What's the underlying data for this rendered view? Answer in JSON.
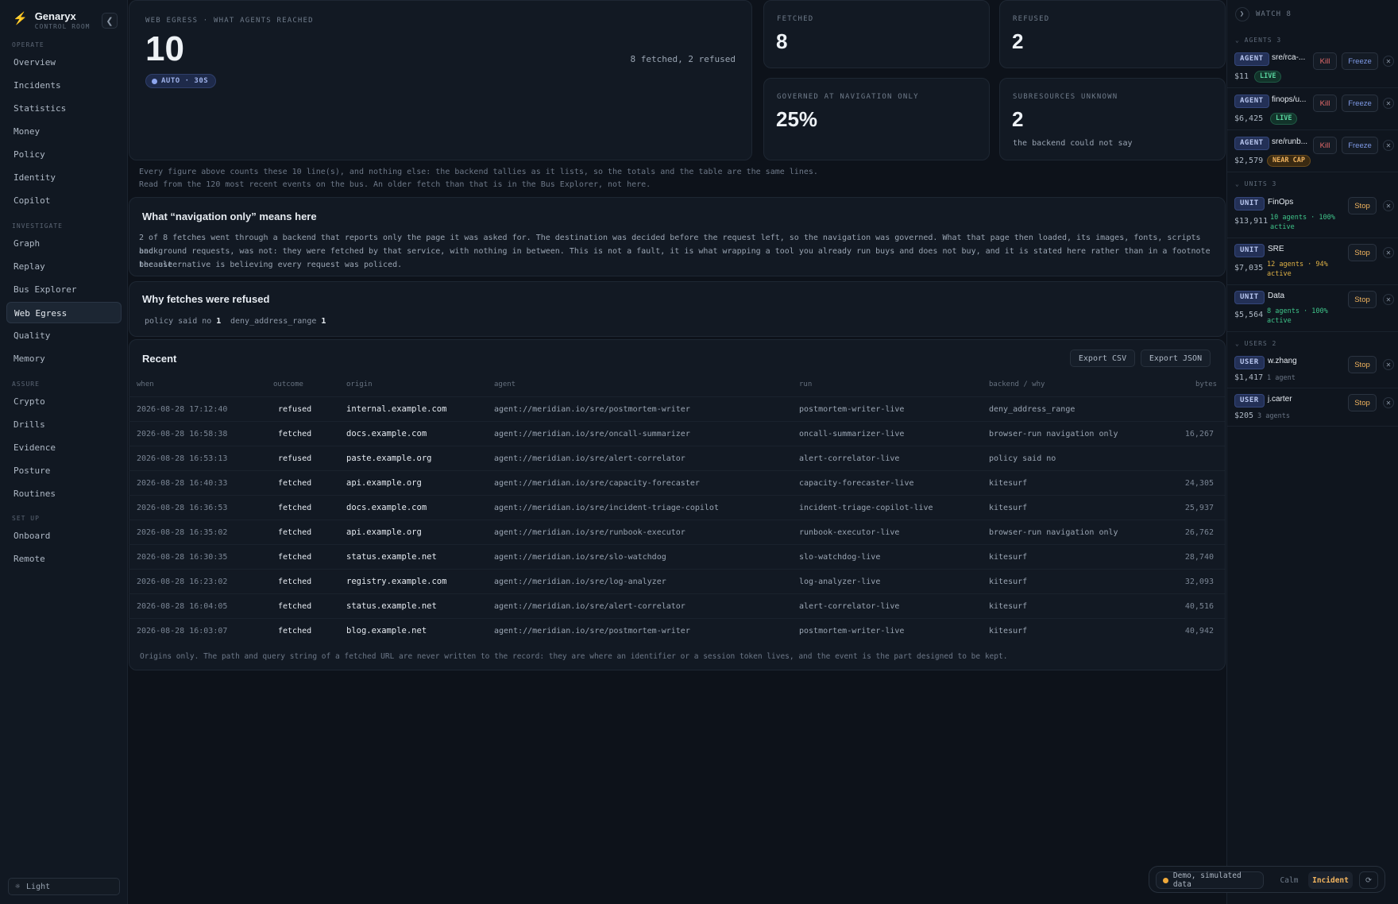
{
  "brand": {
    "name": "Genaryx",
    "subtitle": "CONTROL ROOM"
  },
  "nav": {
    "operate_label": "OPERATE",
    "operate": [
      "Overview",
      "Incidents",
      "Statistics",
      "Money",
      "Policy",
      "Identity",
      "Copilot"
    ],
    "investigate_label": "INVESTIGATE",
    "investigate": [
      "Graph",
      "Replay",
      "Bus Explorer",
      "Web Egress",
      "Quality",
      "Memory"
    ],
    "assure_label": "ASSURE",
    "assure": [
      "Crypto",
      "Drills",
      "Evidence",
      "Posture",
      "Routines"
    ],
    "setup_label": "SET UP",
    "setup": [
      "Onboard",
      "Remote"
    ],
    "active": "Web Egress",
    "theme_label": "Light"
  },
  "hero": {
    "label": "WEB EGRESS · WHAT AGENTS REACHED",
    "value": "10",
    "summary": "8 fetched, 2 refused",
    "auto_chip": "AUTO · 30S"
  },
  "kpis": {
    "fetched": {
      "label": "FETCHED",
      "value": "8"
    },
    "refused": {
      "label": "REFUSED",
      "value": "2"
    },
    "governed": {
      "label": "GOVERNED AT NAVIGATION ONLY",
      "value": "25%"
    },
    "subresources": {
      "label": "SUBRESOURCES UNKNOWN",
      "value": "2",
      "note": "the backend could not say"
    }
  },
  "notes": {
    "line1": "Every figure above counts these 10 line(s), and nothing else: the backend tallies as it lists, so the totals and the table are the same lines.",
    "line2": "Read from the 120 most recent events on the bus. An older fetch than that is in the Bus Explorer, not here."
  },
  "navigation_only": {
    "title": "What “navigation only” means here",
    "line1": "2 of 8 fetches went through a backend that reports only the page it was asked for. The destination was decided before the request left, so the navigation was governed. What that page then loaded, its images, fonts, scripts and",
    "line2": "background requests, was not: they were fetched by that service, with nothing in between. This is not a fault, it is what wrapping a tool you already run buys and does not buy, and it is stated here rather than in a footnote because",
    "line3": "the alternative is believing every request was policed."
  },
  "refusals": {
    "title": "Why fetches were refused",
    "items": [
      {
        "reason": "policy said no",
        "count": "1"
      },
      {
        "reason": "deny_address_range",
        "count": "1"
      }
    ]
  },
  "recent": {
    "title": "Recent",
    "export_csv": "Export CSV",
    "export_json": "Export JSON",
    "columns": {
      "when": "when",
      "outcome": "outcome",
      "origin": "origin",
      "agent": "agent",
      "run": "run",
      "backend": "backend / why",
      "bytes": "bytes"
    },
    "rows": [
      {
        "when": "2026-08-28 17:12:40",
        "outcome": "refused",
        "origin": "internal.example.com",
        "agent": "agent://meridian.io/sre/postmortem-writer",
        "run": "postmortem-writer-live",
        "backend": "deny_address_range",
        "bytes": ""
      },
      {
        "when": "2026-08-28 16:58:38",
        "outcome": "fetched",
        "origin": "docs.example.com",
        "agent": "agent://meridian.io/sre/oncall-summarizer",
        "run": "oncall-summarizer-live",
        "backend": "browser-run navigation only",
        "bytes": "16,267"
      },
      {
        "when": "2026-08-28 16:53:13",
        "outcome": "refused",
        "origin": "paste.example.org",
        "agent": "agent://meridian.io/sre/alert-correlator",
        "run": "alert-correlator-live",
        "backend": "policy said no",
        "bytes": ""
      },
      {
        "when": "2026-08-28 16:40:33",
        "outcome": "fetched",
        "origin": "api.example.org",
        "agent": "agent://meridian.io/sre/capacity-forecaster",
        "run": "capacity-forecaster-live",
        "backend": "kitesurf",
        "bytes": "24,305"
      },
      {
        "when": "2026-08-28 16:36:53",
        "outcome": "fetched",
        "origin": "docs.example.com",
        "agent": "agent://meridian.io/sre/incident-triage-copilot",
        "run": "incident-triage-copilot-live",
        "backend": "kitesurf",
        "bytes": "25,937"
      },
      {
        "when": "2026-08-28 16:35:02",
        "outcome": "fetched",
        "origin": "api.example.org",
        "agent": "agent://meridian.io/sre/runbook-executor",
        "run": "runbook-executor-live",
        "backend": "browser-run navigation only",
        "bytes": "26,762"
      },
      {
        "when": "2026-08-28 16:30:35",
        "outcome": "fetched",
        "origin": "status.example.net",
        "agent": "agent://meridian.io/sre/slo-watchdog",
        "run": "slo-watchdog-live",
        "backend": "kitesurf",
        "bytes": "28,740"
      },
      {
        "when": "2026-08-28 16:23:02",
        "outcome": "fetched",
        "origin": "registry.example.com",
        "agent": "agent://meridian.io/sre/log-analyzer",
        "run": "log-analyzer-live",
        "backend": "kitesurf",
        "bytes": "32,093"
      },
      {
        "when": "2026-08-28 16:04:05",
        "outcome": "fetched",
        "origin": "status.example.net",
        "agent": "agent://meridian.io/sre/alert-correlator",
        "run": "alert-correlator-live",
        "backend": "kitesurf",
        "bytes": "40,516"
      },
      {
        "when": "2026-08-28 16:03:07",
        "outcome": "fetched",
        "origin": "blog.example.net",
        "agent": "agent://meridian.io/sre/postmortem-writer",
        "run": "postmortem-writer-live",
        "backend": "kitesurf",
        "bytes": "40,942"
      }
    ],
    "footnote": "Origins only. The path and query string of a fetched URL are never written to the record: they are where an identifier or a session token lives, and the event is the part designed to be kept."
  },
  "watch": {
    "title": "WATCH 8",
    "agents_label": "AGENTS 3",
    "agents": [
      {
        "tag": "AGENT",
        "name": "sre/rca-...",
        "money": "$11",
        "status": "LIVE",
        "kill": "Kill",
        "freeze": "Freeze"
      },
      {
        "tag": "AGENT",
        "name": "finops/u...",
        "money": "$6,425",
        "status": "LIVE",
        "kill": "Kill",
        "freeze": "Freeze"
      },
      {
        "tag": "AGENT",
        "name": "sre/runb...",
        "money": "$2,579",
        "status": "NEAR CAP",
        "kill": "Kill",
        "freeze": "Freeze"
      }
    ],
    "units_label": "UNITS 3",
    "units": [
      {
        "tag": "UNIT",
        "name": "FinOps",
        "money": "$13,911",
        "stat1": "10 agents · 100%",
        "stat2": "active",
        "stop": "Stop"
      },
      {
        "tag": "UNIT",
        "name": "SRE",
        "money": "$7,035",
        "stat1": "12 agents · 94%",
        "stat2": "active",
        "stop": "Stop"
      },
      {
        "tag": "UNIT",
        "name": "Data",
        "money": "$5,564",
        "stat1": "8 agents · 100%",
        "stat2": "active",
        "stop": "Stop"
      }
    ],
    "users_label": "USERS 2",
    "users": [
      {
        "tag": "USER",
        "name": "w.zhang",
        "money": "$1,417",
        "sub": "1 agent",
        "stop": "Stop"
      },
      {
        "tag": "USER",
        "name": "j.carter",
        "money": "$205",
        "sub": "3 agents",
        "stop": "Stop"
      }
    ]
  },
  "demo": {
    "label": "Demo, simulated data",
    "calm": "Calm",
    "incident": "Incident"
  },
  "colors": {
    "accent": "#7f9be8",
    "live": "#58d39e",
    "warn": "#f0b35e",
    "danger": "#e46a6a"
  }
}
